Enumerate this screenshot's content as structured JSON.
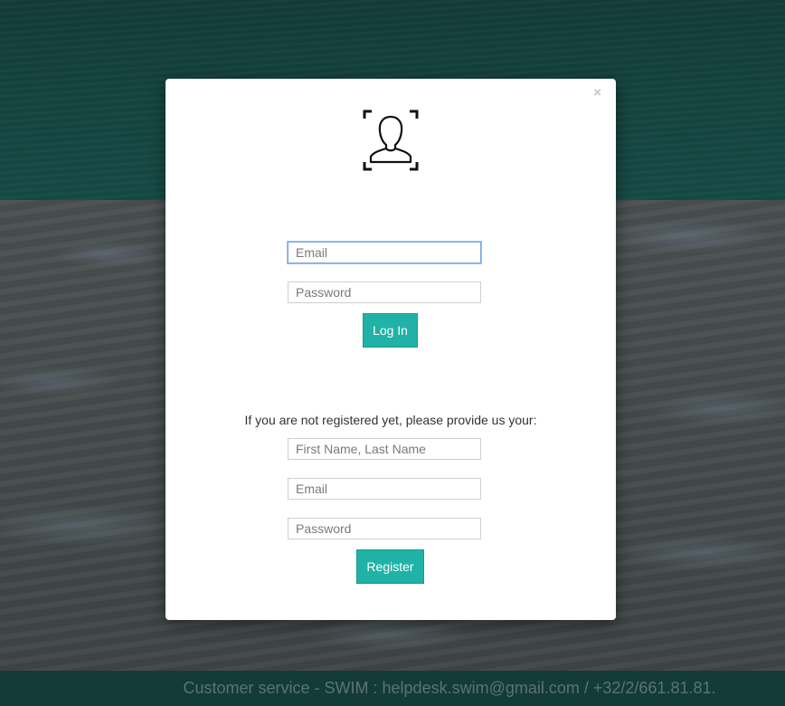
{
  "modal": {
    "close_label": "×",
    "icon": "user-profile-icon",
    "login": {
      "email_placeholder": "Email",
      "password_placeholder": "Password",
      "button_label": "Log In"
    },
    "register": {
      "prompt": "If you are not registered yet, please provide us your:",
      "name_placeholder": "First Name, Last Name",
      "email_placeholder": "Email",
      "password_placeholder": "Password",
      "button_label": "Register"
    }
  },
  "footer": {
    "text": "Customer service - SWIM : helpdesk.swim@gmail.com / +32/2/661.81.81."
  },
  "colors": {
    "accent": "#20b2a6",
    "header_bg": "#154540",
    "footer_bg": "#133b37"
  }
}
